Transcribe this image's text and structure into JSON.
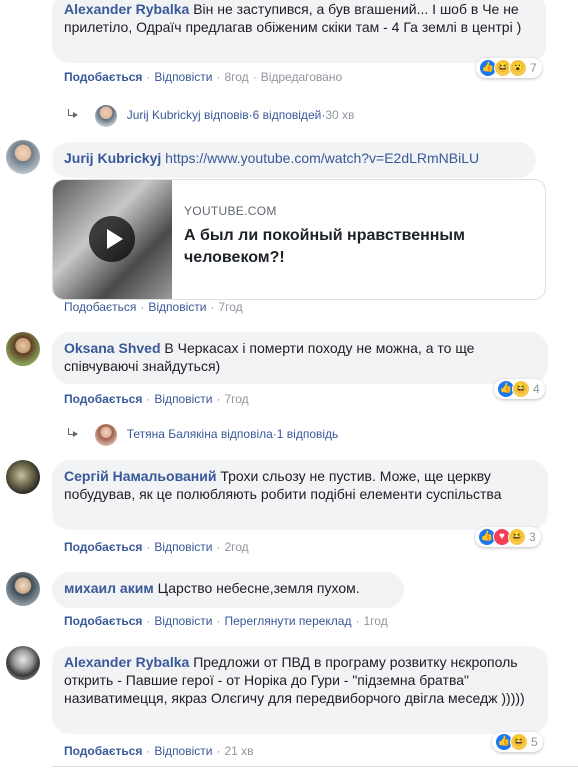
{
  "comments": [
    {
      "author": "Alexander Rybalka",
      "text": "Він не заступився, а був вгашений... І шоб в Че не прилетіло, Одраїч предлагав обіженим скіки там - 4 Га землі в центрі )",
      "like": "Подобається",
      "reply": "Відповісти",
      "time": "8год",
      "extra": "Відредаговано",
      "reactions_count": "7",
      "reply_summary": {
        "who": "Jurij Kubrickyj відповів",
        "count": "6 відповідей",
        "time": "30 хв"
      }
    },
    {
      "author": "Jurij Kubrickyj",
      "text": "https://www.youtube.com/watch?v=E2dLRmNBiLU",
      "like": "Подобається",
      "reply": "Відповісти",
      "time": "7год",
      "preview": {
        "domain": "YOUTUBE.COM",
        "title": "А был ли покойный нравственным человеком?!"
      }
    },
    {
      "author": "Oksana Shved",
      "text": "В Черкасах і померти походу не можна, а то ще співчуваючі знайдуться)",
      "like": "Подобається",
      "reply": "Відповісти",
      "time": "7год",
      "reactions_count": "4",
      "reply_summary": {
        "who": "Тетяна Балякіна відповіла",
        "count": "1 відповідь",
        "time": ""
      }
    },
    {
      "author": "Сергій Намальований",
      "text": "Трохи сльозу не пустив. Може, ще церкву побудував, як це полюбляють робити подібні елементи суспільства",
      "like": "Подобається",
      "reply": "Відповісти",
      "time": "2год",
      "reactions_count": "3"
    },
    {
      "author": "михаил аким",
      "text": "Царство небесне,земля пухом.",
      "like": "Подобається",
      "reply": "Відповісти",
      "translate": "Переглянути переклад",
      "time": "1год"
    },
    {
      "author": "Alexander Rybalka",
      "text": "Предложи от ПВД в програму розвитку нєкрополь открить - Павшие герої - от Норіка до Гури - \"підземна братва\" називатимецця, якраз Олєгичу для передвиборчого двігла меседж )))))",
      "like": "Подобається",
      "reply": "Відповісти",
      "time": "21 хв",
      "reactions_count": "5"
    }
  ],
  "separator": "·",
  "colors": {
    "link": "#385898",
    "bubble": "#f2f3f5",
    "meta": "#90949c",
    "like": "#1877f2",
    "haha": "#f7c94a",
    "love": "#f33e58"
  }
}
